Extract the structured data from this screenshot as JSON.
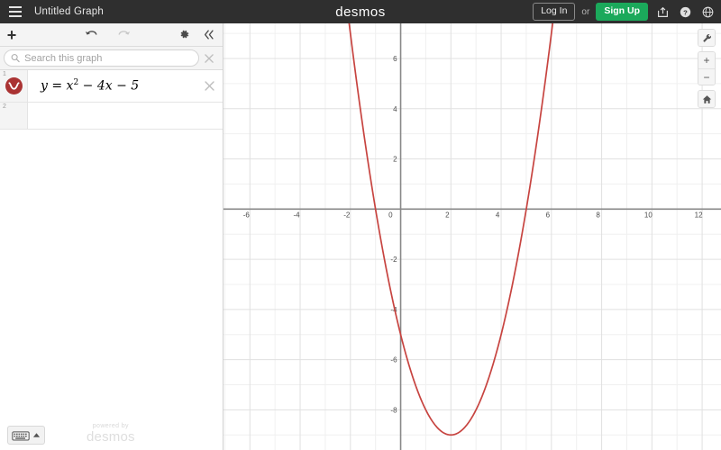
{
  "header": {
    "menu_icon": "hamburger-icon",
    "title": "Untitled Graph",
    "logo": "desmos",
    "login_label": "Log In",
    "or_label": "or",
    "signup_label": "Sign Up",
    "share_icon": "share-icon",
    "help_icon": "help-circle-icon",
    "language_icon": "globe-icon",
    "bg_color": "#2f2f2f",
    "signup_color": "#1ba95b"
  },
  "toolbar": {
    "add_label": "+",
    "undo_icon": "undo-arrow-icon",
    "redo_icon": "redo-arrow-icon",
    "settings_icon": "gear-icon",
    "collapse_icon": "double-chevron-left-icon"
  },
  "search": {
    "placeholder": "Search this graph",
    "value": "",
    "search_icon": "magnifier-icon",
    "clear_icon": "close-x-icon"
  },
  "expressions": {
    "rows": [
      {
        "number": "1",
        "icon": "parabola-curve-icon",
        "color": "#c74440",
        "lhs": "y",
        "equals": "=",
        "term1_base": "x",
        "term1_exp": "2",
        "term2": "− 4x",
        "term3": "− 5",
        "full_text": "y = x² − 4x − 5",
        "delete_icon": "close-x-icon"
      },
      {
        "number": "2",
        "icon": "",
        "full_text": ""
      }
    ]
  },
  "footer": {
    "keyboard_icon": "keyboard-icon",
    "keyboard_caret_icon": "caret-up-icon",
    "powered_by": "powered by",
    "brand": "desmos"
  },
  "graph_controls": {
    "wrench_icon": "wrench-icon",
    "zoom_in_label": "+",
    "zoom_out_label": "−",
    "home_icon": "home-icon"
  },
  "chart_data": {
    "type": "line",
    "title": "",
    "expression": "y = x^2 - 4x - 5",
    "curve_color": "#c74440",
    "xlabel": "",
    "ylabel": "",
    "xlim": [
      -7.05,
      12.75
    ],
    "ylim": [
      -9.6,
      7.4
    ],
    "xticks": [
      -6,
      -4,
      -2,
      0,
      2,
      4,
      6,
      8,
      10,
      12
    ],
    "xtick_labels": [
      "-6",
      "-4",
      "-2",
      "0",
      "2",
      "4",
      "6",
      "8",
      "10",
      "12"
    ],
    "yticks": [
      6,
      4,
      2,
      0,
      -2,
      -4,
      -6,
      -8
    ],
    "ytick_labels": [
      "6",
      "4",
      "2",
      "0",
      "-2",
      "-4",
      "-6",
      "-8"
    ],
    "grid": true,
    "minor_grid_step": 1,
    "major_grid_step": 2,
    "grid_minor_color": "#f0f0f0",
    "grid_major_color": "#e0e0e0",
    "axis_color": "#888888",
    "vertex": [
      2,
      -9
    ],
    "roots": [
      -1,
      5
    ],
    "y_intercept": -5,
    "points": [
      [
        -2.0,
        7.0
      ],
      [
        -1.8,
        5.44
      ],
      [
        -1.6,
        3.96
      ],
      [
        -1.4,
        2.56
      ],
      [
        -1.2,
        1.24
      ],
      [
        -1.0,
        0.0
      ],
      [
        -0.8,
        -1.16
      ],
      [
        -0.6,
        -2.24
      ],
      [
        -0.4,
        -3.24
      ],
      [
        -0.2,
        -4.16
      ],
      [
        0.0,
        -5.0
      ],
      [
        0.2,
        -5.76
      ],
      [
        0.4,
        -6.44
      ],
      [
        0.6,
        -7.04
      ],
      [
        0.8,
        -7.56
      ],
      [
        1.0,
        -8.0
      ],
      [
        1.2,
        -8.36
      ],
      [
        1.4,
        -8.64
      ],
      [
        1.6,
        -8.84
      ],
      [
        1.8,
        -8.96
      ],
      [
        2.0,
        -9.0
      ],
      [
        2.2,
        -8.96
      ],
      [
        2.4,
        -8.84
      ],
      [
        2.6,
        -8.64
      ],
      [
        2.8,
        -8.36
      ],
      [
        3.0,
        -8.0
      ],
      [
        3.2,
        -7.56
      ],
      [
        3.4,
        -7.04
      ],
      [
        3.6,
        -6.44
      ],
      [
        3.8,
        -5.76
      ],
      [
        4.0,
        -5.0
      ],
      [
        4.2,
        -4.16
      ],
      [
        4.4,
        -3.24
      ],
      [
        4.6,
        -2.24
      ],
      [
        4.8,
        -1.16
      ],
      [
        5.0,
        0.0
      ],
      [
        5.2,
        1.24
      ],
      [
        5.4,
        2.56
      ],
      [
        5.6,
        3.96
      ],
      [
        5.8,
        5.44
      ],
      [
        6.0,
        7.0
      ]
    ]
  }
}
